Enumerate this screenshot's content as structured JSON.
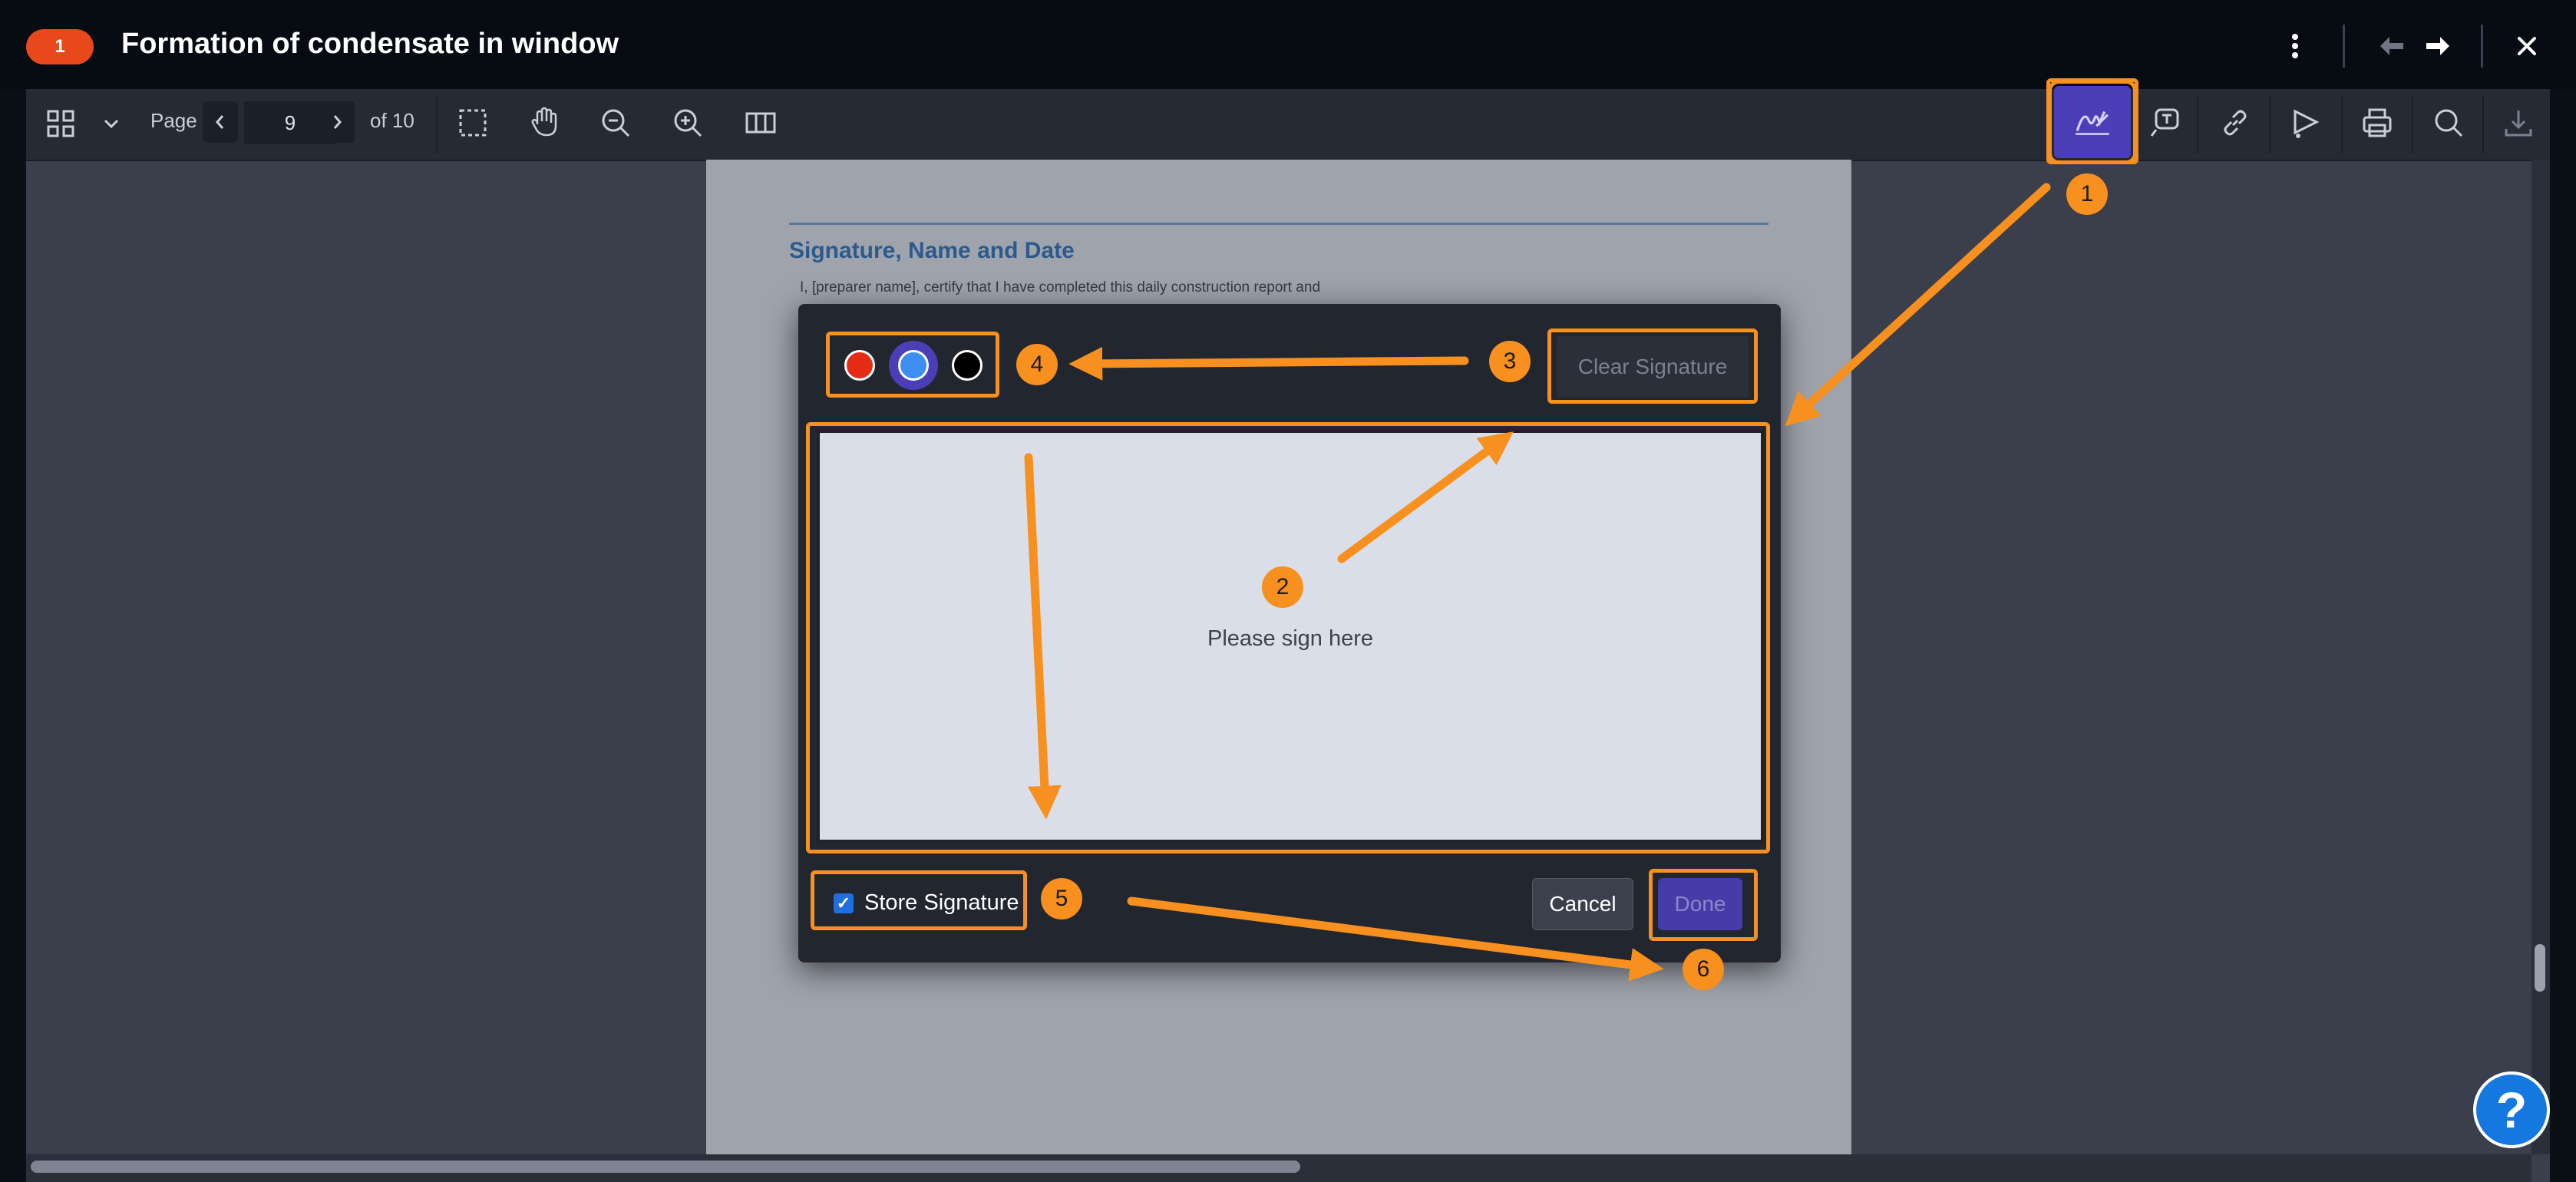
{
  "title_bar": {
    "issue_number": "1",
    "title": "Formation of condensate in window",
    "icons": [
      "more-vertical-icon",
      "arrow-left-icon",
      "arrow-right-icon",
      "close-icon"
    ]
  },
  "toolbar": {
    "page_label": "Page",
    "current_page": "9",
    "page_total": "of 10",
    "tools": [
      "thumbnails-icon",
      "chevron-down-icon",
      "prev-page-icon",
      "next-page-icon",
      "marquee-select-icon",
      "pan-hand-icon",
      "zoom-out-icon",
      "zoom-in-icon",
      "columns-icon",
      "signature-icon",
      "text-box-icon",
      "link-icon",
      "shapes-icon",
      "print-icon",
      "search-icon",
      "download-icon"
    ]
  },
  "document": {
    "heading": "Signature, Name and Date",
    "text": "I, [preparer name], certify that I have completed this daily construction report and"
  },
  "dialog": {
    "colors": [
      "#e52b13",
      "#3d8ef0",
      "#000000"
    ],
    "selected_color": "#3d8ef0",
    "clear_label": "Clear Signature",
    "sign_hint": "Please sign here",
    "store_label": "Store Signature",
    "store_checked": true,
    "cancel_label": "Cancel",
    "done_label": "Done"
  },
  "annotations": {
    "color": "#f7901e",
    "labels": [
      "1",
      "2",
      "3",
      "4",
      "5",
      "6"
    ]
  },
  "help": {
    "label": "?"
  }
}
